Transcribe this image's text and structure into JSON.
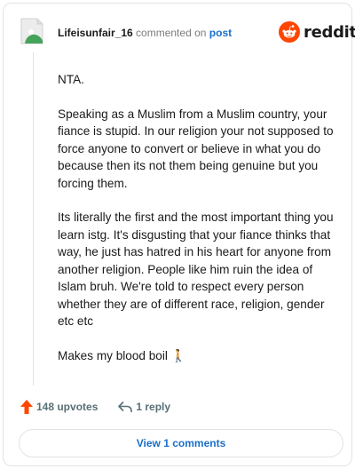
{
  "header": {
    "username": "Lifeisunfair_16",
    "commented_on": "commented on",
    "post_link": "post",
    "logo_text": "reddit"
  },
  "comment": {
    "paragraphs": [
      "NTA.",
      "Speaking as a Muslim from a Muslim country, your fiance is stupid. In our religion your not supposed to force anyone to convert or believe in what you do because then its not them being genuine but you forcing them.",
      "Its literally the first and the most important thing you learn istg. It's disgusting that your fiance thinks that way, he just has hatred in his heart for anyone from another religion. People like him ruin the idea of Islam bruh. We're told to respect every person whether they are of different race, religion, gender etc etc",
      "Makes my blood boil 🚶"
    ]
  },
  "actions": {
    "upvotes_label": "148 upvotes",
    "reply_label": "1 reply",
    "view_comments_label": "View 1 comments"
  },
  "colors": {
    "upvote": "#ff4500",
    "link": "#1a6fc9",
    "reddit_orange": "#ff4500",
    "avatar_green": "#46a35a"
  },
  "icons": {
    "avatar": "default-avatar-icon",
    "logo": "reddit-snoo-icon",
    "upvote": "upvote-arrow-icon",
    "reply": "reply-arrow-icon"
  }
}
